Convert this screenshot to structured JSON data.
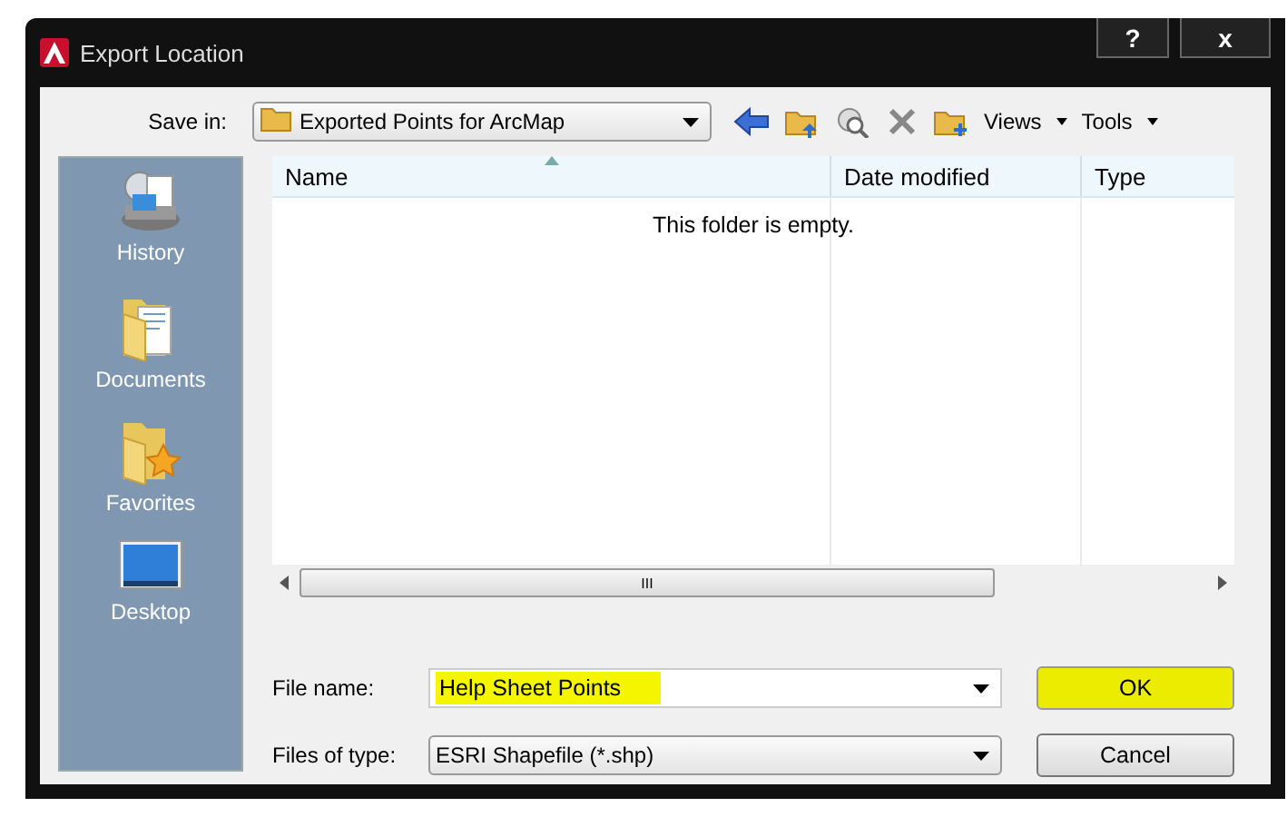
{
  "window": {
    "title": "Export Location",
    "help_button": "?",
    "close_button": "x"
  },
  "save_in": {
    "label": "Save in:",
    "value": "Exported Points for ArcMap"
  },
  "toolbar": {
    "views": "Views",
    "tools": "Tools"
  },
  "places": [
    {
      "label": "History",
      "kind": "history"
    },
    {
      "label": "Documents",
      "kind": "documents"
    },
    {
      "label": "Favorites",
      "kind": "favorites"
    },
    {
      "label": "Desktop",
      "kind": "desktop"
    }
  ],
  "file_list": {
    "columns": [
      "Name",
      "Date modified",
      "Type"
    ],
    "empty_message": "This folder is empty.",
    "scroll_grip": "III"
  },
  "file_name": {
    "label": "File name:",
    "value": "Help Sheet Points",
    "highlighted": true
  },
  "file_type": {
    "label": "Files of type:",
    "value": "ESRI Shapefile  (*.shp)"
  },
  "buttons": [
    {
      "label": "OK",
      "highlighted": true
    },
    {
      "label": "Cancel",
      "highlighted": false
    }
  ]
}
